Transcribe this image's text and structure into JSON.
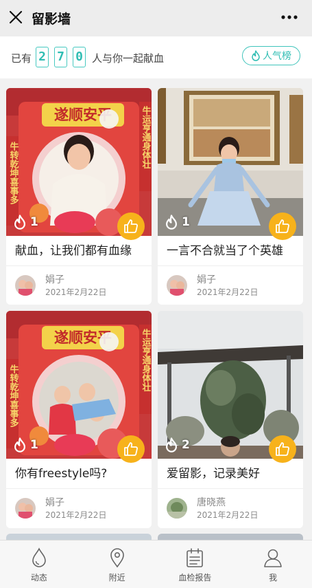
{
  "header": {
    "title": "留影墙",
    "close_icon": "close-icon",
    "more_icon": "more-icon"
  },
  "counter": {
    "prefix": "已有",
    "digits": [
      "2",
      "7",
      "0"
    ],
    "suffix": "人与你一起献血",
    "rank_label": "人气榜",
    "accent": "#2fbdb3"
  },
  "posts": [
    {
      "caption": "献血，让我们都有血缘",
      "likes": "1",
      "author": "娟子",
      "date": "2021年2月22日",
      "photo_banner": "遂顺安平",
      "photo_side_left": "牛转乾坤喜事多",
      "photo_side_right": "牛运亨通身体壮"
    },
    {
      "caption": "一言不合就当了个英雄",
      "likes": "1",
      "author": "娟子",
      "date": "2021年2月22日"
    },
    {
      "caption": "你有freestyle吗?",
      "likes": "1",
      "author": "娟子",
      "date": "2021年2月22日",
      "photo_banner": "遂顺安平",
      "photo_side_left": "牛转乾坤喜事多",
      "photo_side_right": "牛运亨通身体壮"
    },
    {
      "caption": "爱留影，记录美好",
      "likes": "2",
      "author": "唐晓燕",
      "date": "2021年2月22日"
    }
  ],
  "tabs": [
    {
      "label": "动态",
      "icon": "drop-icon"
    },
    {
      "label": "附近",
      "icon": "location-pin-icon"
    },
    {
      "label": "血检报告",
      "icon": "calendar-report-icon"
    },
    {
      "label": "我",
      "icon": "person-icon"
    }
  ],
  "colors": {
    "like_button": "#f7b21b",
    "frame_red": "#d8282f"
  }
}
